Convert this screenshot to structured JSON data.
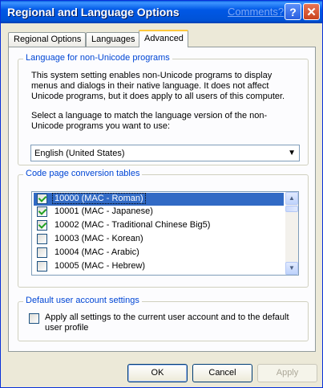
{
  "window": {
    "title": "Regional and Language Options",
    "comments_link": "Comments?",
    "help_button": "?",
    "close_button": "✕"
  },
  "tabs": [
    {
      "label": "Regional Options",
      "active": false
    },
    {
      "label": "Languages",
      "active": false
    },
    {
      "label": "Advanced",
      "active": true
    }
  ],
  "non_unicode": {
    "group_title": "Language for non-Unicode programs",
    "description": "This system setting enables non-Unicode programs to display menus and dialogs in their native language. It does not affect Unicode programs, but it does apply to all users of this computer.",
    "prompt": "Select a language to match the language version of the non-Unicode programs you want to use:",
    "selected_language": "English (United States)"
  },
  "code_pages": {
    "group_title": "Code page conversion tables",
    "items": [
      {
        "label": "10000 (MAC - Roman)",
        "checked": true,
        "selected": true
      },
      {
        "label": "10001 (MAC - Japanese)",
        "checked": true,
        "selected": false
      },
      {
        "label": "10002 (MAC - Traditional Chinese Big5)",
        "checked": true,
        "selected": false
      },
      {
        "label": "10003 (MAC - Korean)",
        "checked": false,
        "selected": false
      },
      {
        "label": "10004 (MAC - Arabic)",
        "checked": false,
        "selected": false
      },
      {
        "label": "10005 (MAC - Hebrew)",
        "checked": false,
        "selected": false
      }
    ]
  },
  "default_settings": {
    "group_title": "Default user account settings",
    "checkbox_label": "Apply all settings to the current user account and to the default user profile",
    "checked": false
  },
  "buttons": {
    "ok": "OK",
    "cancel": "Cancel",
    "apply": "Apply"
  },
  "colors": {
    "titlebar": "#0058e6",
    "accent_text": "#0046d5",
    "selection": "#316ac5",
    "window_bg": "#ece9d8"
  }
}
